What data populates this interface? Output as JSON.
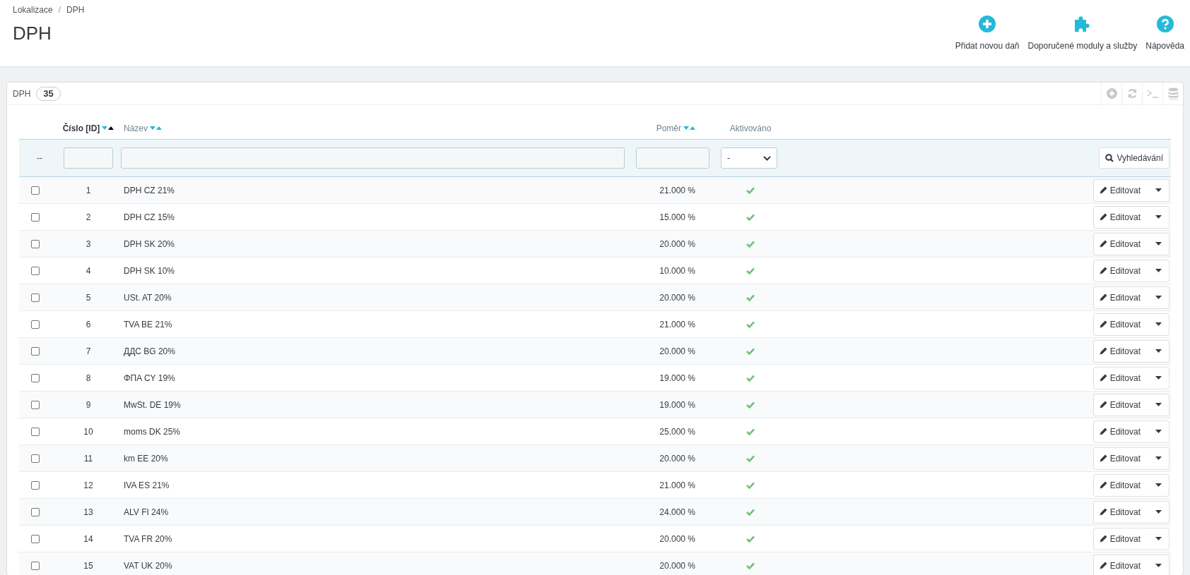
{
  "breadcrumb": [
    "Lokalizace",
    "DPH"
  ],
  "breadcrumb_separator": "/",
  "page_title": "DPH",
  "toolbar": [
    {
      "kind": "add",
      "label": "Přidat novou daň"
    },
    {
      "kind": "modules",
      "label": "Doporučené moduly a služby"
    },
    {
      "kind": "help",
      "label": "Nápověda"
    }
  ],
  "panel": {
    "title": "DPH",
    "count": "35"
  },
  "table": {
    "columns": [
      {
        "kind": "sortable",
        "label": "Číslo [ID]",
        "sorted": true
      },
      {
        "kind": "sortable",
        "label": "Název",
        "sorted": false
      },
      {
        "kind": "sortable",
        "label": "Poměr",
        "sorted": false
      },
      {
        "kind": "plain",
        "label": "Aktivováno"
      }
    ],
    "filter": {
      "reset": "--",
      "active_value": "-",
      "search_button": "Vyhledávání"
    },
    "rows": [
      {
        "checked": false,
        "id": "1",
        "name": "DPH CZ 21%",
        "rate": "21.000 %",
        "active": true,
        "action": "Editovat"
      },
      {
        "checked": false,
        "id": "2",
        "name": "DPH CZ 15%",
        "rate": "15.000 %",
        "active": true,
        "action": "Editovat"
      },
      {
        "checked": false,
        "id": "3",
        "name": "DPH SK 20%",
        "rate": "20.000 %",
        "active": true,
        "action": "Editovat"
      },
      {
        "checked": false,
        "id": "4",
        "name": "DPH SK 10%",
        "rate": "10.000 %",
        "active": true,
        "action": "Editovat"
      },
      {
        "checked": false,
        "id": "5",
        "name": "USt. AT 20%",
        "rate": "20.000 %",
        "active": true,
        "action": "Editovat"
      },
      {
        "checked": false,
        "id": "6",
        "name": "TVA BE 21%",
        "rate": "21.000 %",
        "active": true,
        "action": "Editovat"
      },
      {
        "checked": false,
        "id": "7",
        "name": "ДДС BG 20%",
        "rate": "20.000 %",
        "active": true,
        "action": "Editovat"
      },
      {
        "checked": false,
        "id": "8",
        "name": "ΦΠΑ CY 19%",
        "rate": "19.000 %",
        "active": true,
        "action": "Editovat"
      },
      {
        "checked": false,
        "id": "9",
        "name": "MwSt. DE 19%",
        "rate": "19.000 %",
        "active": true,
        "action": "Editovat"
      },
      {
        "checked": false,
        "id": "10",
        "name": "moms DK 25%",
        "rate": "25.000 %",
        "active": true,
        "action": "Editovat"
      },
      {
        "checked": false,
        "id": "11",
        "name": "km EE 20%",
        "rate": "20.000 %",
        "active": true,
        "action": "Editovat"
      },
      {
        "checked": false,
        "id": "12",
        "name": "IVA ES 21%",
        "rate": "21.000 %",
        "active": true,
        "action": "Editovat"
      },
      {
        "checked": false,
        "id": "13",
        "name": "ALV FI 24%",
        "rate": "24.000 %",
        "active": true,
        "action": "Editovat"
      },
      {
        "checked": false,
        "id": "14",
        "name": "TVA FR 20%",
        "rate": "20.000 %",
        "active": true,
        "action": "Editovat"
      },
      {
        "checked": false,
        "id": "15",
        "name": "VAT UK 20%",
        "rate": "20.000 %",
        "active": true,
        "action": "Editovat"
      }
    ]
  }
}
